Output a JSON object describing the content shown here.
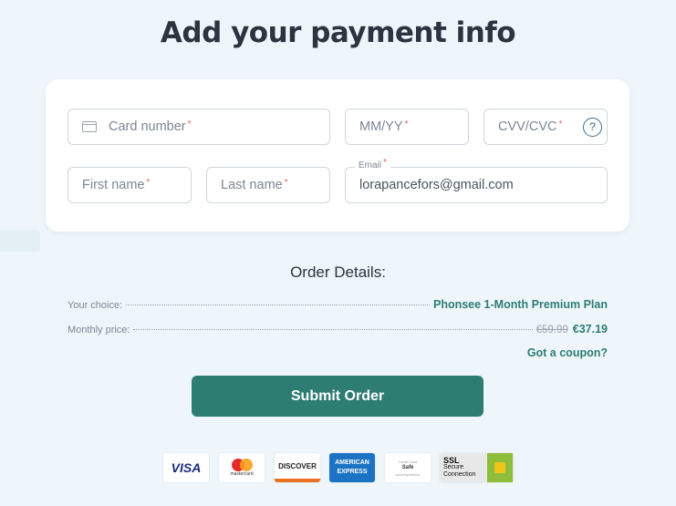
{
  "title": "Add your payment info",
  "form": {
    "card_number": {
      "placeholder": "Card number",
      "required": "*"
    },
    "expiry": {
      "placeholder": "MM/YY",
      "required": "*"
    },
    "cvv": {
      "placeholder": "CVV/CVC",
      "required": "*",
      "help_icon": "?"
    },
    "first_name": {
      "placeholder": "First name",
      "required": "*"
    },
    "last_name": {
      "placeholder": "Last name",
      "required": "*"
    },
    "email": {
      "label": "Email",
      "required": "*",
      "value": "lorapancefors@gmail.com"
    }
  },
  "order": {
    "heading": "Order Details:",
    "choice_label": "Your choice:",
    "choice_value": "Phonsee 1-Month Premium Plan",
    "price_label": "Monthly price:",
    "old_price": "€59.99",
    "new_price": "€37.19",
    "coupon": "Got a coupon?"
  },
  "submit_label": "Submit Order",
  "badges": {
    "visa": "VISA",
    "mastercard": "mastercard",
    "discover": "DISCOVER",
    "amex_1": "AMERICAN",
    "amex_2": "EXPRESS",
    "safe_1": "Credit Card",
    "safe_2": "Safe",
    "safe_3": "securitymetrics",
    "ssl_1": "SSL",
    "ssl_2": "Secure",
    "ssl_3": "Connection"
  },
  "colors": {
    "accent": "#2d7d73",
    "background": "#eef6fb",
    "required": "#e0625a"
  }
}
